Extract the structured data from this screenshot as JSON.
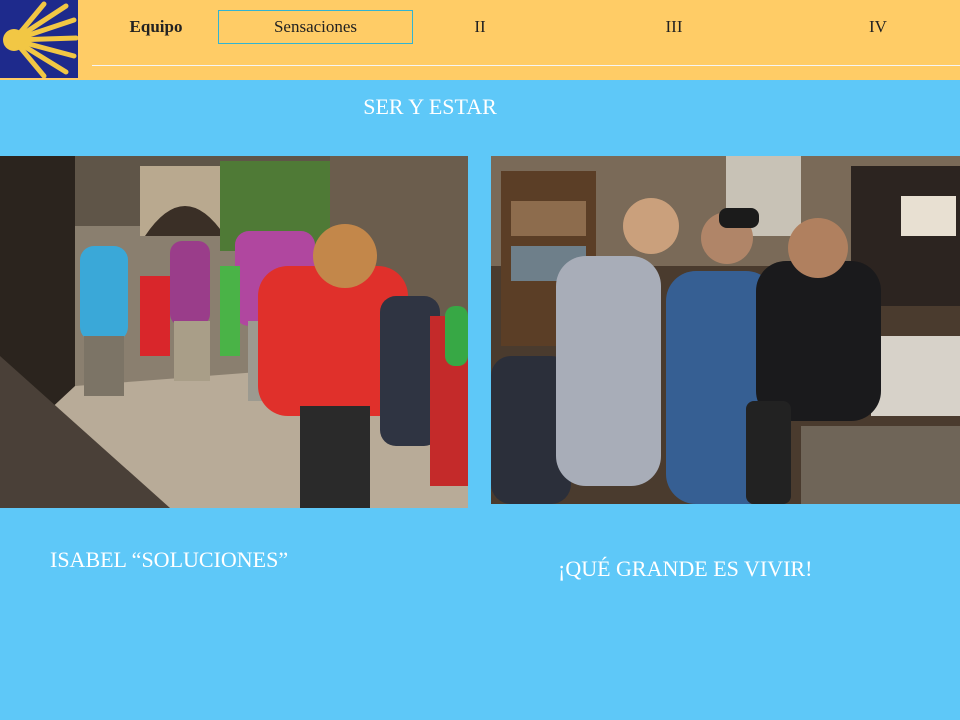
{
  "nav": {
    "items": [
      {
        "label": "Equipo"
      },
      {
        "label": "Sensaciones"
      },
      {
        "label": "II"
      },
      {
        "label": "III"
      },
      {
        "label": "IV"
      }
    ]
  },
  "logo": {
    "icon": "scallop-shell-icon",
    "bg": "#1e2a8c",
    "fg": "#f2c744"
  },
  "heading": "SER Y ESTAR",
  "photos": {
    "left": {
      "icon": "photo-group-dancing"
    },
    "right": {
      "icon": "photo-three-men-portrait"
    }
  },
  "captions": {
    "left": "ISABEL “SOLUCIONES”",
    "right": "¡QUÉ GRANDE ES VIVIR!"
  },
  "colors": {
    "page_bg": "#5ec8f8",
    "topbar_bg": "#ffcc66",
    "active_border": "#32b4d2",
    "text_light": "#ffffff"
  }
}
